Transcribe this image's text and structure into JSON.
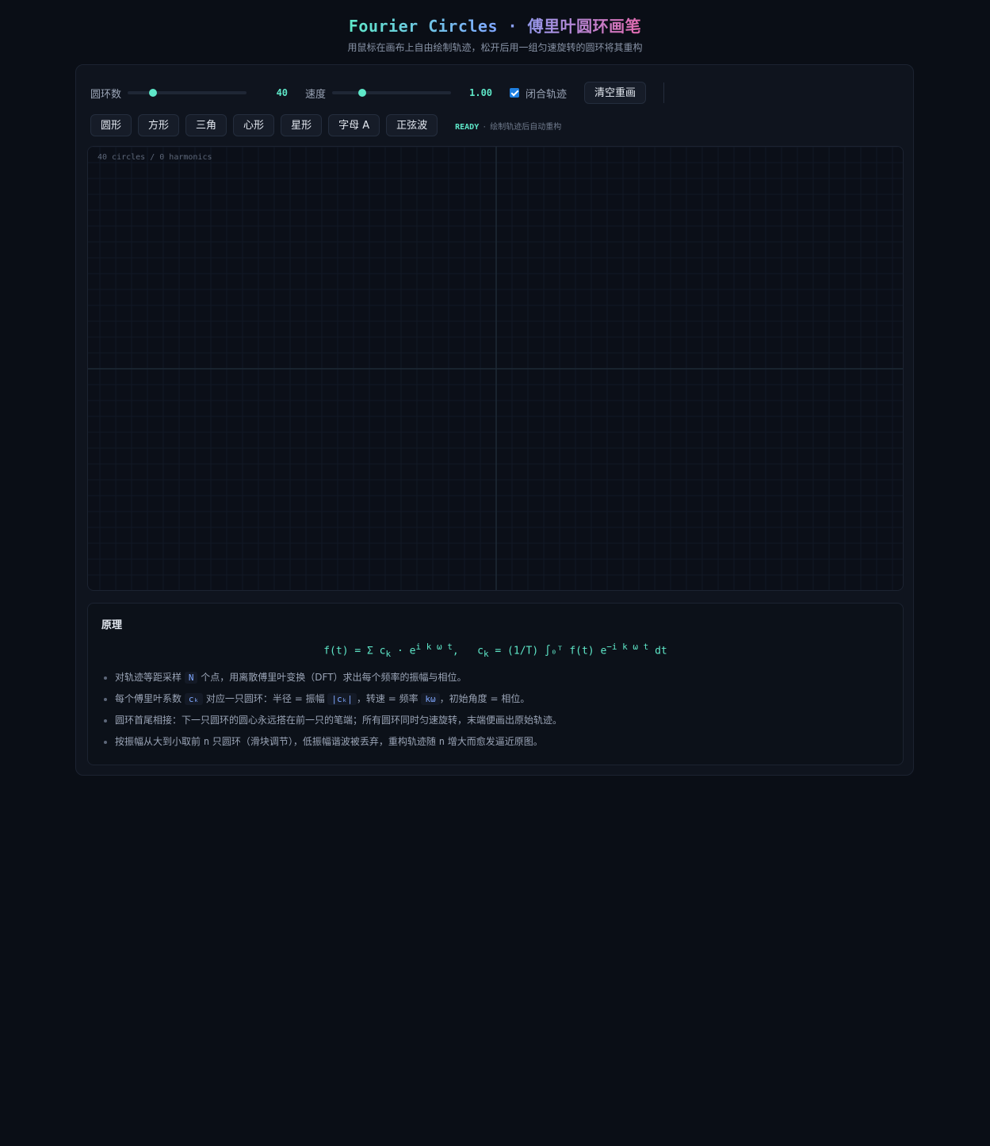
{
  "header": {
    "title": "Fourier Circles · 傅里叶圆环画笔",
    "subtitle": "用鼠标在画布上自由绘制轨迹，松开后用一组匀速旋转的圆环将其重构"
  },
  "controls": {
    "circles_label": "圆环数",
    "circles_value": "40",
    "circles_fraction": 0.21,
    "speed_label": "速度",
    "speed_value": "1.00",
    "speed_fraction": 0.25,
    "close_label": "闭合轨迹",
    "close_checked": true,
    "clear_label": "清空重画"
  },
  "presets": [
    "圆形",
    "方形",
    "三角",
    "心形",
    "星形",
    "字母 A",
    "正弦波"
  ],
  "status": {
    "state": "READY",
    "separator": "·",
    "hint": "绘制轨迹后自动重构"
  },
  "canvas": {
    "info": "40 circles / 0 harmonics"
  },
  "principle": {
    "heading": "原理",
    "formula": {
      "left": "f(t) = Σ c",
      "k1": "k",
      "mid1": " · e",
      "exp1": "i k ω t",
      "mid2": ",   c",
      "k2": "k",
      "mid3": " = (1/T) ∫₀ᵀ f(t) e",
      "exp2": "−i k ω t",
      "right": " dt"
    },
    "items": [
      {
        "a": "对轨迹等距采样 ",
        "code": "N",
        "b": " 个点，用离散傅里叶变换（DFT）求出每个频率的振幅与相位。"
      },
      {
        "a": "每个傅里叶系数 ",
        "code": "cₖ",
        "b": " 对应一只圆环：半径 = 振幅 ",
        "code2": "|cₖ|",
        "c": "，转速 = 频率 ",
        "code3": "kω",
        "d": "，初始角度 = 相位。"
      },
      {
        "a": "圆环首尾相接：下一只圆环的圆心永远搭在前一只的笔端；所有圆环同时匀速旋转，末端便画出原始轨迹。"
      },
      {
        "a": "按振幅从大到小取前 ",
        "var": "n",
        "b": " 只圆环（滑块调节），低振幅谐波被丢弃，重构轨迹随 ",
        "var2": "n",
        "c": " 增大而愈发逼近原图。"
      }
    ]
  }
}
